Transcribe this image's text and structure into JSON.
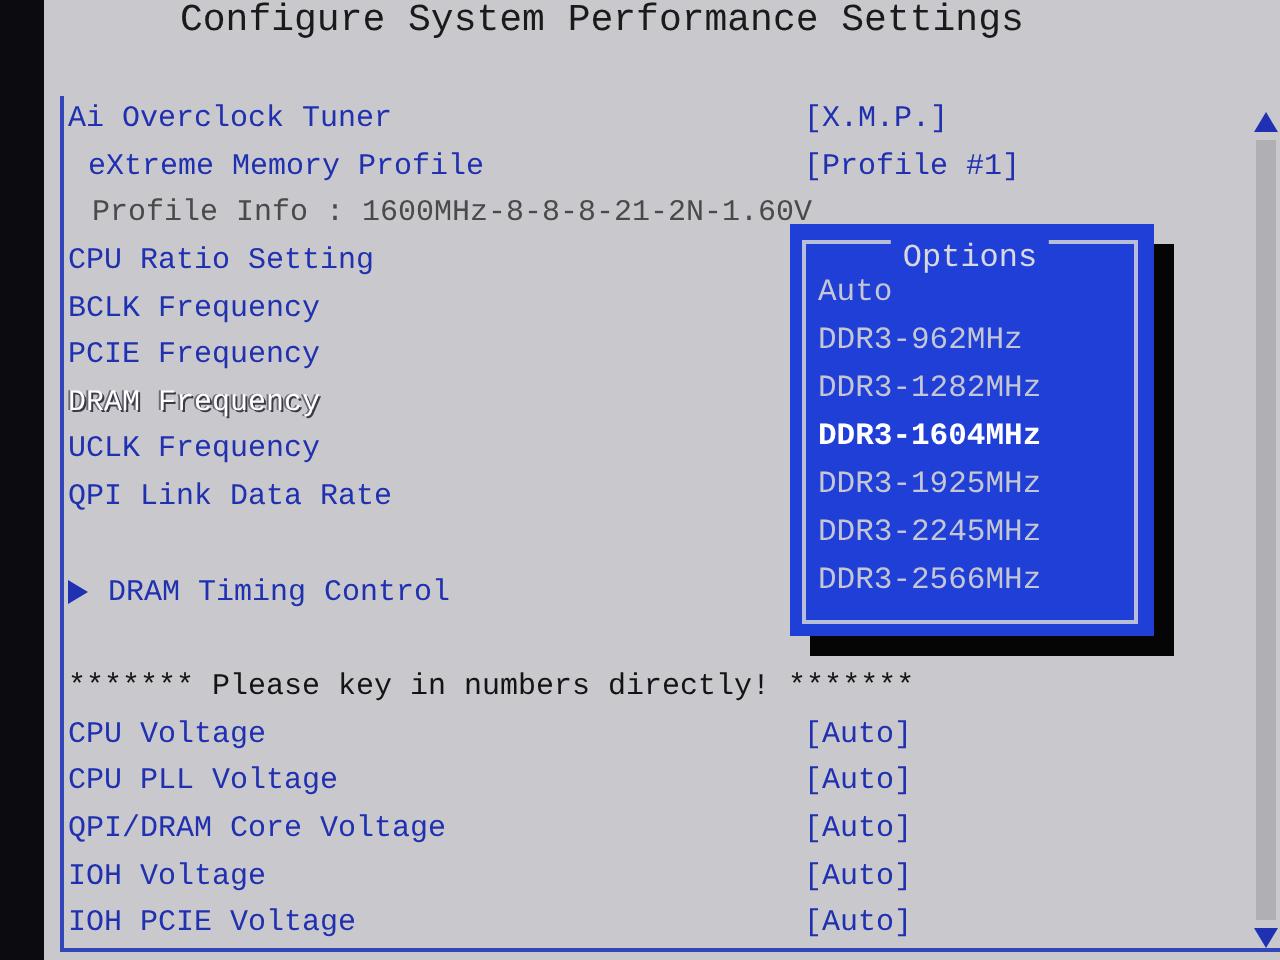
{
  "title": "Configure System Performance Settings",
  "items": [
    {
      "kind": "setting",
      "label": "Ai Overclock Tuner",
      "value": "[X.M.P.]",
      "selected": false
    },
    {
      "kind": "subsetting",
      "label": "eXtreme Memory Profile",
      "value": "[Profile #1]",
      "selected": false
    },
    {
      "kind": "info",
      "label": "Profile Info : 1600MHz-8-8-8-21-2N-1.60V"
    },
    {
      "kind": "setting",
      "label": "CPU Ratio Setting",
      "selected": false
    },
    {
      "kind": "setting",
      "label": "BCLK Frequency",
      "selected": false
    },
    {
      "kind": "setting",
      "label": "PCIE Frequency",
      "selected": false
    },
    {
      "kind": "setting",
      "label": "DRAM Frequency",
      "selected": true
    },
    {
      "kind": "setting",
      "label": "UCLK Frequency",
      "selected": false
    },
    {
      "kind": "setting",
      "label": "QPI Link Data Rate",
      "selected": false
    },
    {
      "kind": "gap"
    },
    {
      "kind": "submenu",
      "label": "DRAM Timing Control",
      "selected": false
    },
    {
      "kind": "gap"
    },
    {
      "kind": "note",
      "label": "******* Please key in numbers directly! *******"
    },
    {
      "kind": "setting",
      "label": "CPU Voltage",
      "value": "[Auto]",
      "selected": false
    },
    {
      "kind": "setting",
      "label": "CPU PLL Voltage",
      "value": "[Auto]",
      "selected": false
    },
    {
      "kind": "setting",
      "label": "QPI/DRAM Core Voltage",
      "value": "[Auto]",
      "selected": false
    },
    {
      "kind": "setting",
      "label": "IOH Voltage",
      "value": "[Auto]",
      "selected": false
    },
    {
      "kind": "setting",
      "label": "IOH PCIE Voltage",
      "value": "[Auto]",
      "selected": false
    }
  ],
  "popup": {
    "title": "Options",
    "options": [
      {
        "label": "Auto",
        "selected": false
      },
      {
        "label": "DDR3-962MHz",
        "selected": false
      },
      {
        "label": "DDR3-1282MHz",
        "selected": false
      },
      {
        "label": "DDR3-1604MHz",
        "selected": true
      },
      {
        "label": "DDR3-1925MHz",
        "selected": false
      },
      {
        "label": "DDR3-2245MHz",
        "selected": false
      },
      {
        "label": "DDR3-2566MHz",
        "selected": false
      }
    ]
  }
}
